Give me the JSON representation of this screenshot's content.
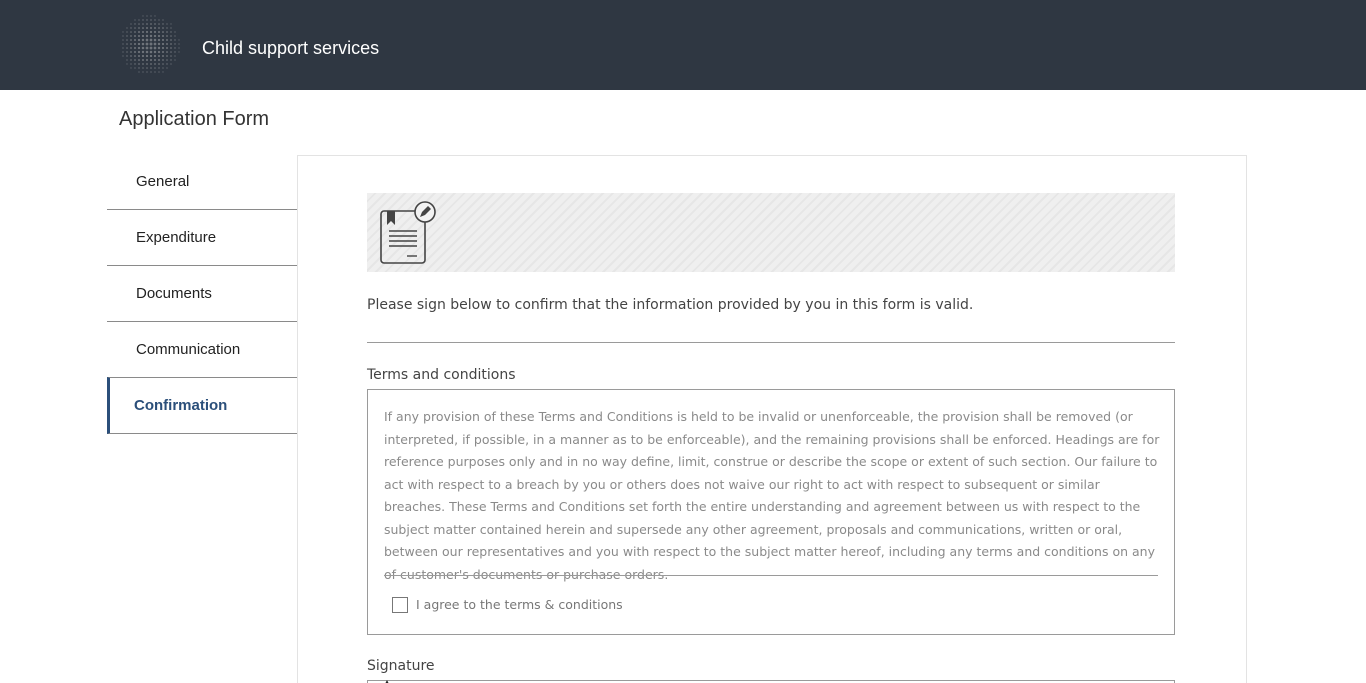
{
  "header": {
    "logo_icon": "dotted-sphere-logo",
    "app_title": "Child support services"
  },
  "page": {
    "title": "Application Form"
  },
  "sidebar": {
    "items": [
      {
        "label": "General",
        "active": false
      },
      {
        "label": "Expenditure",
        "active": false
      },
      {
        "label": "Documents",
        "active": false
      },
      {
        "label": "Communication",
        "active": false
      },
      {
        "label": "Confirmation",
        "active": true
      }
    ]
  },
  "confirmation": {
    "banner_icon": "document-edit-icon",
    "intro_text": "Please sign below to confirm that the information provided by you in this form is valid.",
    "terms_label": "Terms and conditions",
    "terms_text": "If any provision of these Terms and Conditions is held to be invalid or unenforceable, the provision shall be removed (or interpreted, if possible, in a manner as to be enforceable), and the remaining provisions shall be enforced. Headings are for reference purposes only and in no way define, limit, construe or describe the scope or extent of such section. Our failure to act with respect to a breach by you or others does not waive our right to act with respect to subsequent or similar breaches. These Terms and Conditions set forth the entire understanding and agreement between us with respect to the subject matter contained herein and supersede any other agreement, proposals and communications, written or oral, between our representatives and you with respect to the subject matter hereof, including any terms and conditions on any of customer's documents or purchase orders.",
    "agree_label": "I agree to the terms & conditions",
    "agree_checked": false,
    "signature_label": "Signature"
  },
  "colors": {
    "header_bg": "#2f3742",
    "accent": "#2b4f7a"
  }
}
